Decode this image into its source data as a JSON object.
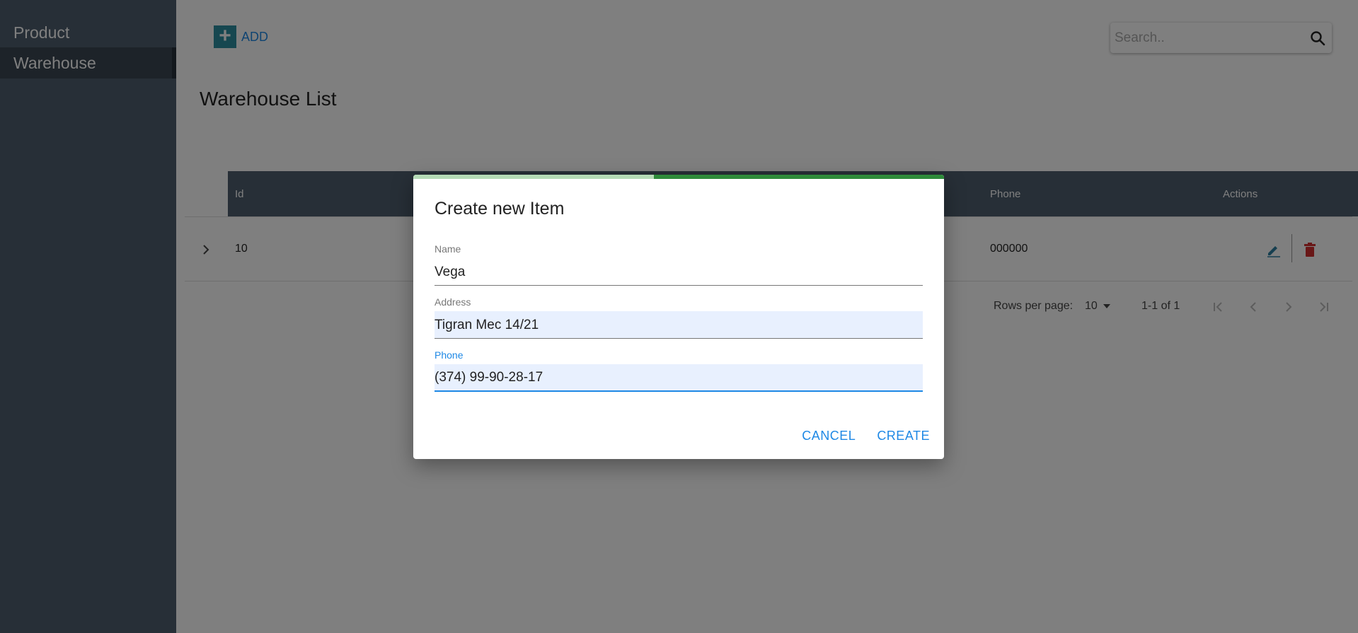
{
  "sidebar": {
    "items": [
      {
        "label": "Product"
      },
      {
        "label": "Warehouse"
      }
    ]
  },
  "toolbar": {
    "add_label": "ADD",
    "search_placeholder": "Search.."
  },
  "page": {
    "title": "Warehouse List"
  },
  "table": {
    "columns": {
      "id": "Id",
      "phone": "Phone",
      "actions": "Actions"
    },
    "rows": [
      {
        "id": "10",
        "phone": "000000"
      }
    ]
  },
  "pagination": {
    "rows_per_page_label": "Rows per page:",
    "rows_per_page_value": "10",
    "range": "1-1 of 1"
  },
  "dialog": {
    "title": "Create new Item",
    "fields": {
      "name": {
        "label": "Name",
        "value": "Vega"
      },
      "address": {
        "label": "Address",
        "value": "Tigran Mec 14/21"
      },
      "phone": {
        "label": "Phone",
        "value": "(374) 99-90-28-17"
      }
    },
    "cancel_label": "CANCEL",
    "create_label": "CREATE"
  },
  "colors": {
    "sidebar": "#4f5f6f",
    "accent": "#1e88e5",
    "progress": "#2e8b3a",
    "delete": "#d32f2f"
  }
}
